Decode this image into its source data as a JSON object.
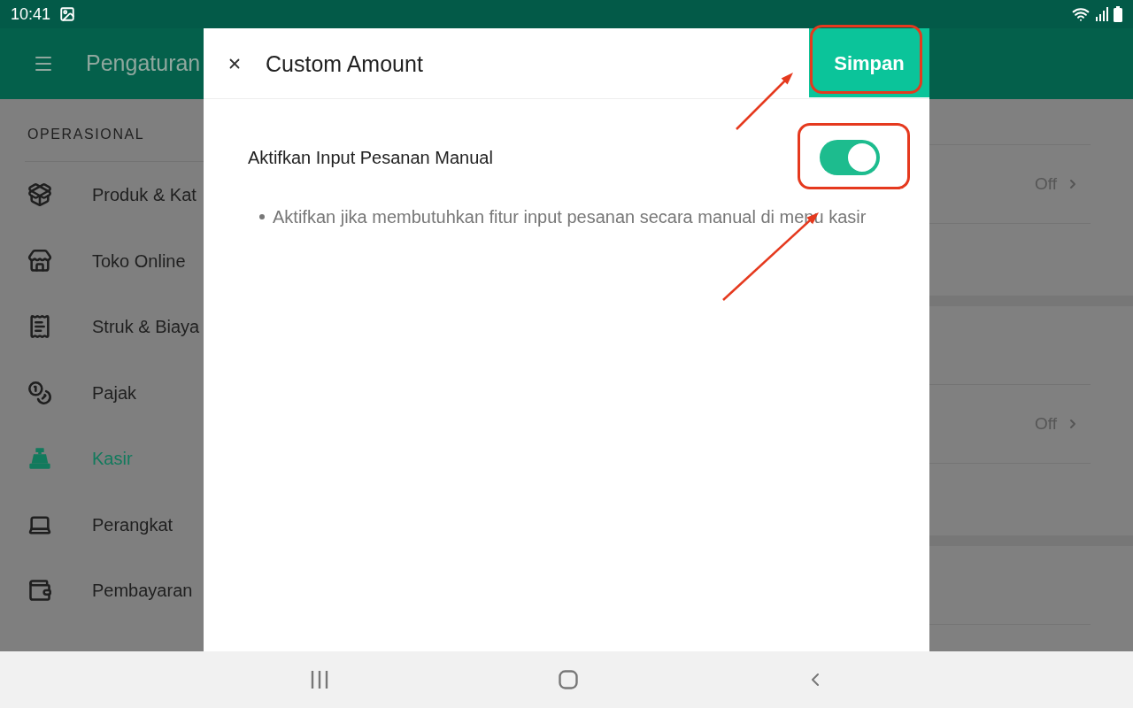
{
  "status_bar": {
    "time": "10:41"
  },
  "app_bar": {
    "title": "Pengaturan"
  },
  "sidebar": {
    "section_title": "OPERASIONAL",
    "items": [
      {
        "label": "Produk & Kat",
        "selected": false
      },
      {
        "label": "Toko Online",
        "selected": false
      },
      {
        "label": "Struk & Biaya",
        "selected": false
      },
      {
        "label": "Pajak",
        "selected": false
      },
      {
        "label": "Kasir",
        "selected": true
      },
      {
        "label": "Perangkat",
        "selected": false
      },
      {
        "label": "Pembayaran",
        "selected": false
      }
    ]
  },
  "settings_list": {
    "rows": [
      {
        "value": "Off"
      },
      {
        "value": "Off"
      }
    ]
  },
  "dialog": {
    "title": "Custom Amount",
    "save_button": "Simpan",
    "setting": {
      "label": "Aktifkan Input Pesanan Manual",
      "on": true
    },
    "notes": [
      "Aktifkan jika membutuhkan fitur input pesanan secara manual di menu kasir"
    ]
  }
}
